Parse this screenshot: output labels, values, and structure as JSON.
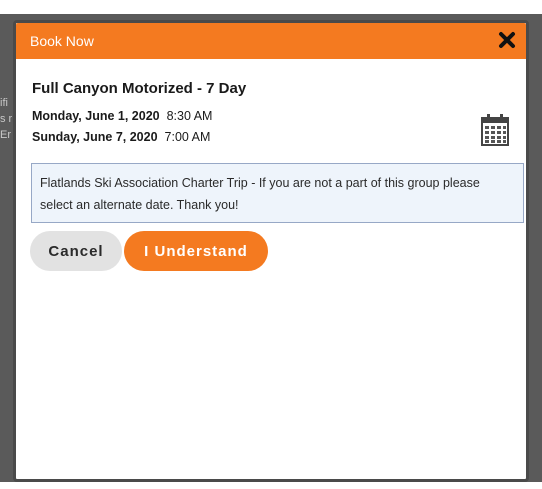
{
  "backdrop": {
    "fragments": [
      "ifi",
      "s r",
      "Er"
    ]
  },
  "modal": {
    "header_title": "Book Now",
    "close_icon": "close-x-icon",
    "trip_title": "Full Canyon Motorized - 7 Day",
    "start": {
      "day": "Monday, June 1, 2020",
      "time": "8:30 AM"
    },
    "end": {
      "day": "Sunday, June 7, 2020",
      "time": "7:00 AM"
    },
    "calendar_icon": "calendar-icon",
    "notice_text": "Flatlands Ski Association Charter Trip - If you are not a part of this group please select an alternate date. Thank you!",
    "cancel_label": "Cancel",
    "understand_label": "I Understand"
  },
  "colors": {
    "accent": "#f47a20",
    "notice_bg": "#eef4fb",
    "notice_border": "#97a8c6",
    "cancel_bg": "#e2e2e2"
  }
}
